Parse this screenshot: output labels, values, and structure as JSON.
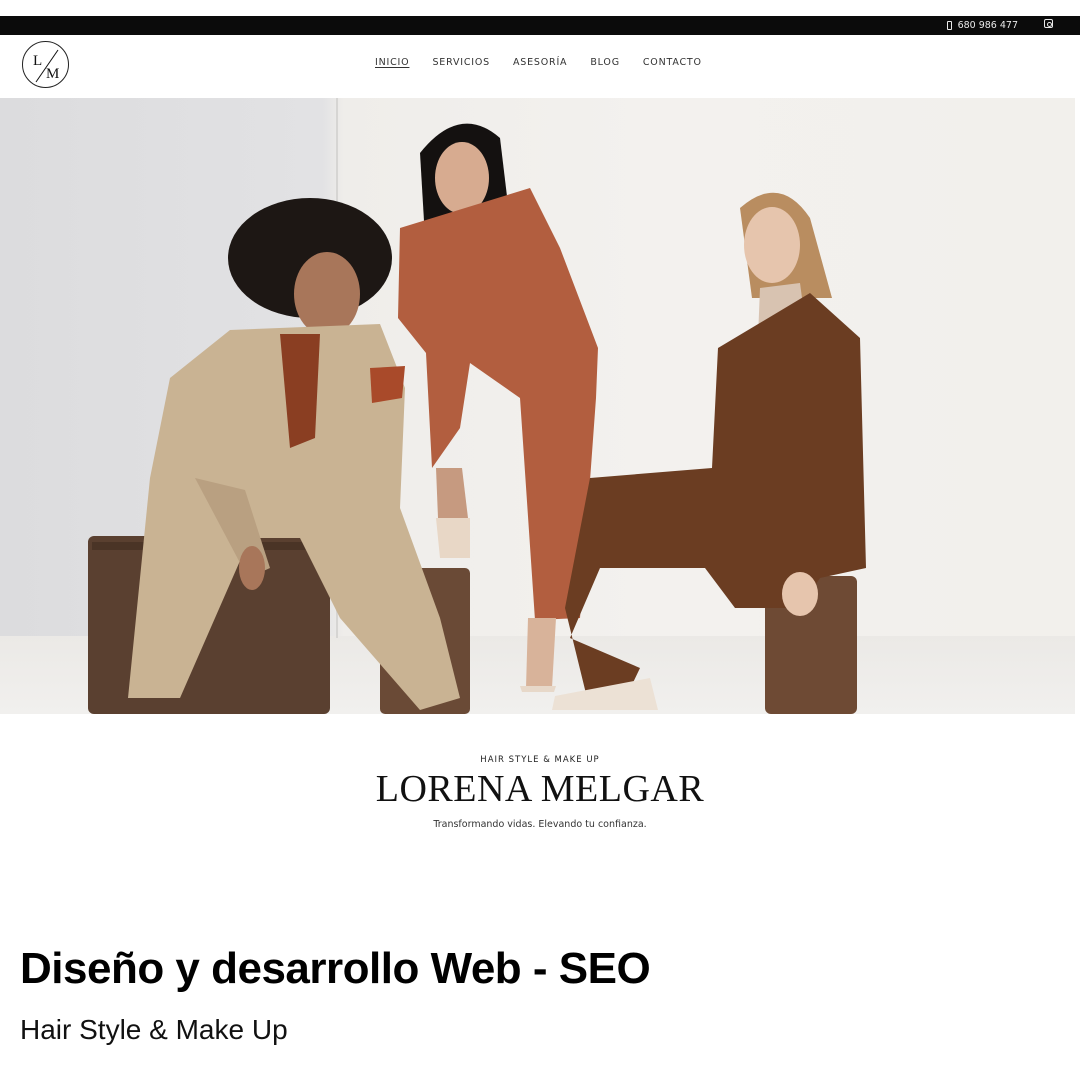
{
  "topbar": {
    "phone_icon": "phone-icon",
    "phone": "680 986 477",
    "social_icon": "instagram-icon"
  },
  "header": {
    "logo_text": "L/M",
    "nav": [
      {
        "label": "INICIO",
        "active": true
      },
      {
        "label": "SERVICIOS",
        "active": false
      },
      {
        "label": "ASESORÍA",
        "active": false
      },
      {
        "label": "BLOG",
        "active": false
      },
      {
        "label": "CONTACTO",
        "active": false
      }
    ]
  },
  "hero": {
    "image": "three-models-in-suits-photo"
  },
  "brand": {
    "kicker": "HAIR STYLE & MAKE UP",
    "name": "LORENA MELGAR",
    "tagline": "Transformando vidas.  Elevando tu confianza."
  },
  "caption": {
    "title": "Diseño y desarrollo Web - SEO",
    "subtitle": "Hair Style & Make Up"
  },
  "colors": {
    "topbar": "#0b0b0b",
    "beige_suit": "#c9b393",
    "rust_suit": "#b25e3f",
    "brown_suit": "#6b3d22",
    "suitcase": "#5a4030"
  }
}
